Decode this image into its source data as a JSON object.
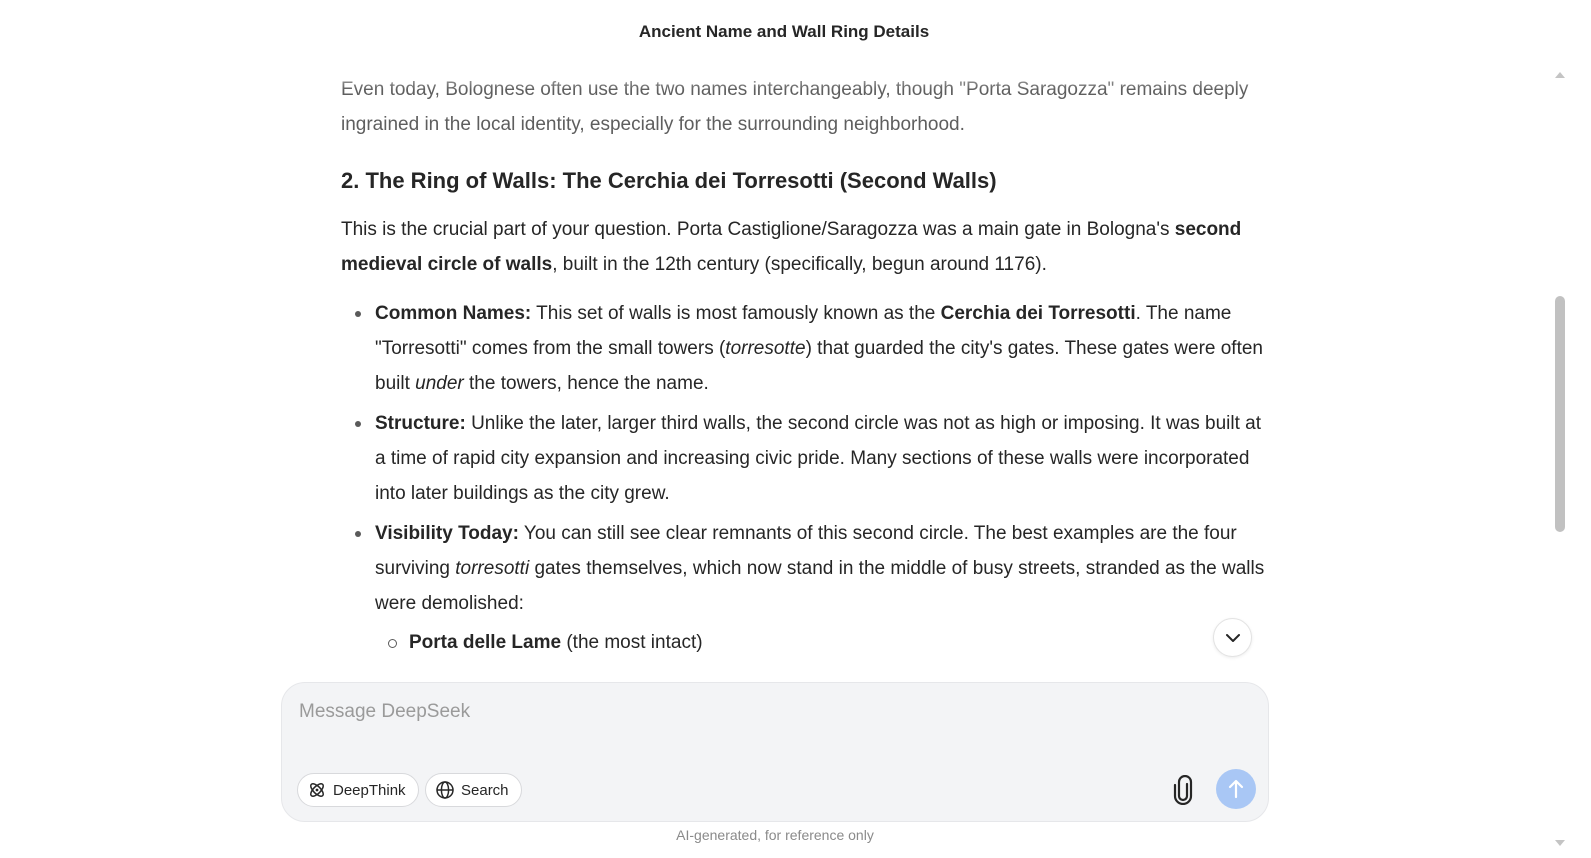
{
  "header": {
    "title": "Ancient Name and Wall Ring Details"
  },
  "message": {
    "p_top": "Even today, Bolognese often use the two names interchangeably, though \"Porta Saragozza\" remains deeply ingrained in the local identity, especially for the surrounding neighborhood.",
    "heading": "2. The Ring of Walls: The Cerchia dei Torresotti (Second Walls)",
    "intro_a": "This is the crucial part of your question. Porta Castiglione/Saragozza was a main gate in Bologna's ",
    "intro_bold": "second medieval circle of walls",
    "intro_b": ", built in the 12th century (specifically, begun around 1176).",
    "bullets": [
      {
        "label": "Common Names:",
        "t1": " This set of walls is most famously known as the ",
        "bold": "Cerchia dei Torresotti",
        "t2": ". The name \"Torresotti\" comes from the small towers (",
        "em1": "torresotte",
        "t3": ") that guarded the city's gates. These gates were often built ",
        "em2": "under",
        "t4": " the towers, hence the name."
      },
      {
        "label": "Structure:",
        "text": " Unlike the later, larger third walls, the second circle was not as high or imposing. It was built at a time of rapid city expansion and increasing civic pride. Many sections of these walls were incorporated into later buildings as the city grew."
      },
      {
        "label": "Visibility Today:",
        "t1": " You can still see clear remnants of this second circle. The best examples are the four surviving ",
        "em": "torresotti",
        "t2": " gates themselves, which now stand in the middle of busy streets, stranded as the walls were demolished:"
      }
    ],
    "sub_items": [
      {
        "bold": "Porta delle Lame",
        "text": " (the most intact)"
      }
    ]
  },
  "composer": {
    "placeholder": "Message DeepSeek",
    "value": "",
    "deepthink_label": "DeepThink",
    "search_label": "Search"
  },
  "footer": {
    "disclaimer": "AI-generated, for reference only"
  },
  "icons": {
    "scroll_down": "chevron-down-icon",
    "deepthink": "atom-icon",
    "search": "globe-icon",
    "attach": "paperclip-icon",
    "send": "arrow-up-icon"
  },
  "colors": {
    "send_disabled": "#a9c7f5",
    "composer_bg": "#f3f4f6"
  }
}
